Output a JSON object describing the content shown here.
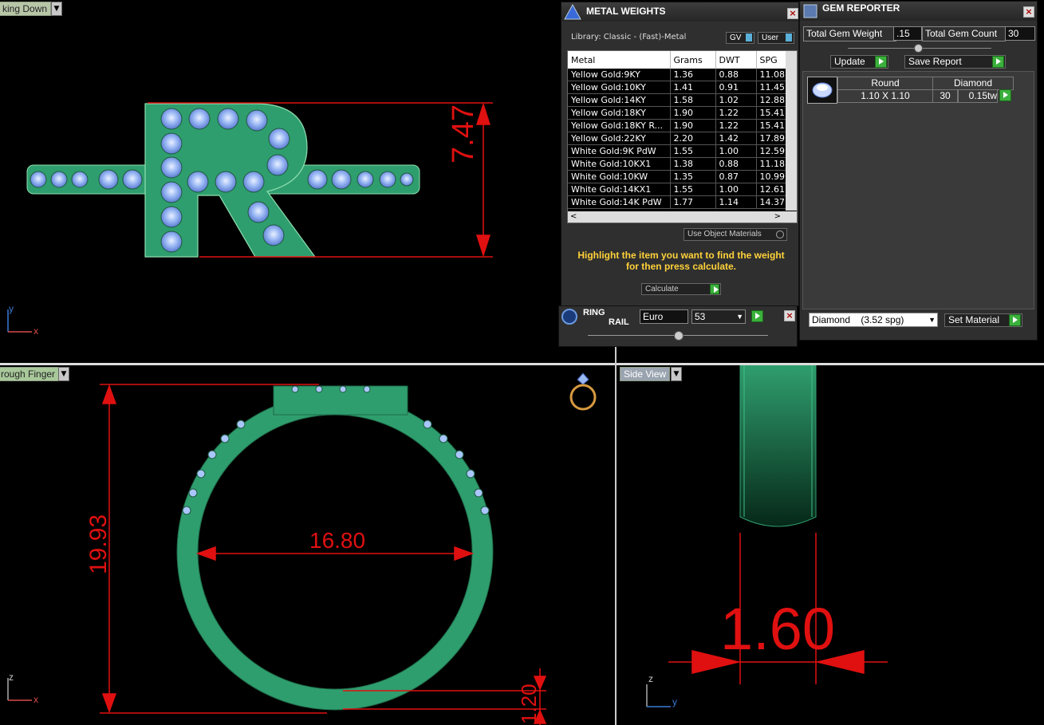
{
  "viewports": {
    "top_left": {
      "label": "king Down",
      "dim_height": "7.47",
      "axis_y": "y",
      "axis_x": "x"
    },
    "bottom_left": {
      "label": "rough Finger",
      "dim_height": "19.93",
      "dim_inner": "16.80",
      "dim_thickness": "1.20",
      "axis_z": "z",
      "axis_x": "x"
    },
    "bottom_right": {
      "label": "Side View",
      "dim_width": "1.60",
      "axis_z": "z",
      "axis_y": "y"
    }
  },
  "metal_weights": {
    "title": "METAL WEIGHTS",
    "library": "Library: Classic - (Fast)-Metal",
    "gv_label": "GV",
    "user_label": "User",
    "columns": [
      "Metal",
      "Grams",
      "DWT",
      "SPG"
    ],
    "rows": [
      [
        "Yellow Gold:9KY",
        "1.36",
        "0.88",
        "11.08"
      ],
      [
        "Yellow Gold:10KY",
        "1.41",
        "0.91",
        "11.45"
      ],
      [
        "Yellow Gold:14KY",
        "1.58",
        "1.02",
        "12.88"
      ],
      [
        "Yellow Gold:18KY",
        "1.90",
        "1.22",
        "15.41"
      ],
      [
        "Yellow Gold:18KY R...",
        "1.90",
        "1.22",
        "15.41"
      ],
      [
        "Yellow Gold:22KY",
        "2.20",
        "1.42",
        "17.89"
      ],
      [
        "White Gold:9K PdW",
        "1.55",
        "1.00",
        "12.59"
      ],
      [
        "White Gold:10KX1",
        "1.38",
        "0.88",
        "11.18"
      ],
      [
        "White Gold:10KW",
        "1.35",
        "0.87",
        "10.99"
      ],
      [
        "White Gold:14KX1",
        "1.55",
        "1.00",
        "12.61"
      ],
      [
        "White Gold:14K PdW",
        "1.77",
        "1.14",
        "14.37"
      ]
    ],
    "use_object_materials": "Use Object Materials",
    "instruction": "Highlight the item you want to find the weight for then press calculate.",
    "calculate": "Calculate"
  },
  "ring_rail": {
    "title_line1": "RING",
    "title_line2": "RAIL",
    "size_system": "Euro",
    "size_value": "53"
  },
  "gem_reporter": {
    "title": "GEM REPORTER",
    "total_weight_label": "Total Gem Weight",
    "total_weight_value": ".15",
    "total_count_label": "Total Gem Count",
    "total_count_value": "30",
    "update": "Update",
    "save_report": "Save Report",
    "gem_shape": "Round",
    "gem_type": "Diamond",
    "gem_size": "1.10 X 1.10",
    "gem_count": "30",
    "gem_weight": "0.15tw",
    "material_select": "Diamond    (3.52 spg)",
    "set_material": "Set Material"
  },
  "colors": {
    "model": "#2f9e6e",
    "dimension": "#e01010",
    "gem": "#a9c6ff",
    "title_yellow": "#ffd23a"
  }
}
